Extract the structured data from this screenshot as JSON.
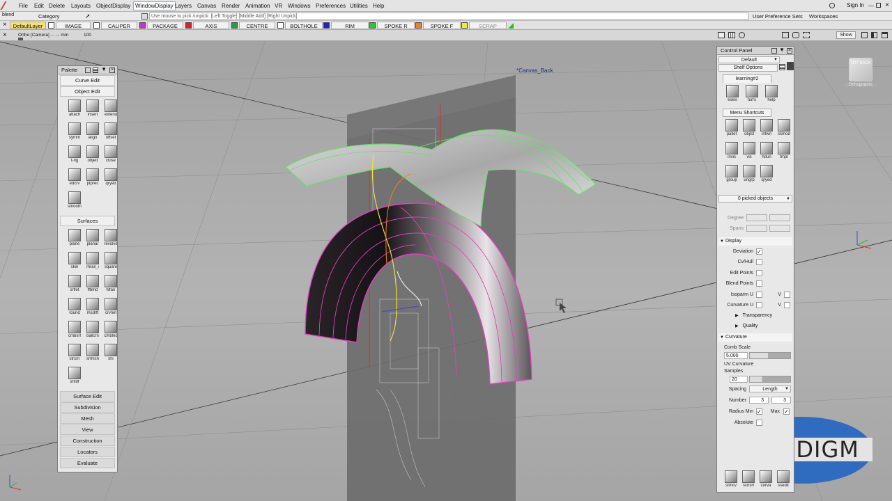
{
  "app": {
    "context_label": "blend",
    "sign_in": "Sign In"
  },
  "menubar": {
    "items": [
      "File",
      "Edit",
      "Delete",
      "Layouts",
      "ObjectDisplay",
      "WindowDisplay",
      "Layers",
      "Canvas",
      "Render",
      "Animation",
      "VR",
      "Windows",
      "Preferences",
      "Utilities",
      "Help"
    ],
    "active_item": "WindowDisplay"
  },
  "toolbar2": {
    "category_label": "Category",
    "hint": "Use mouse to pick /unpick: [Left Toggle] [Middle Add] [Right Unpick]",
    "user_pref_sets": "User Preference Sets",
    "workspaces": "Workspaces"
  },
  "layers": [
    {
      "label": "DefaultLayer",
      "color": "#f6e07a"
    },
    {
      "label": "IMAGE",
      "color": "#ffffff"
    },
    {
      "label": "CALIPER",
      "color": "#d22fd2"
    },
    {
      "label": "PACKAGE",
      "color": "#e02020"
    },
    {
      "label": "AXIS",
      "color": "#22a040"
    },
    {
      "label": "CENTRE",
      "color": "#ffffff"
    },
    {
      "label": "BOLTHOLE",
      "color": "#2020d0"
    },
    {
      "label": "RIM",
      "color": "#20d020"
    },
    {
      "label": "SPOKE R",
      "color": "#f08020"
    },
    {
      "label": "SPOKE F",
      "color": "#f0f020"
    },
    {
      "label": "SCRAP",
      "color": "#20c020"
    }
  ],
  "viewport": {
    "camera_label": "Ortho [Camera] ←→ mm",
    "zoom_value": "100",
    "canvas_label": "*Canvas_Back",
    "show_button": "Show",
    "viewcube_top": "TOP",
    "viewcube_side": "BACK",
    "viewcube_caption": "Orthographic"
  },
  "palette": {
    "title": "Palette",
    "sections_top": [
      "Curve Edit",
      "Object Edit"
    ],
    "object_edit_tools": [
      "attach",
      "insert",
      "extend",
      "symm",
      "align",
      "offset",
      "t-rlg",
      "objed",
      "close",
      "edcrv",
      "ptprec",
      "qryed",
      "smooth"
    ],
    "surfaces_label": "Surfaces",
    "surface_tools": [
      "plane",
      "planar",
      "revolve",
      "skin",
      "mrail_i",
      "square",
      "srflet",
      "ffblnd",
      "filfan",
      "round",
      "msdrft",
      "crvnet",
      "cmbsrf",
      "ballcrn",
      "cmblnd",
      "strcrn",
      "srfmsh",
      "sfs",
      "srfoff"
    ],
    "sections_bottom": [
      "Surface Edit",
      "Subdivision",
      "Mesh",
      "View",
      "Construction",
      "Locators",
      "Evaluate"
    ]
  },
  "control_panel": {
    "title": "Control Panel",
    "preset": "Default",
    "shelf_options": "Shelf Options",
    "shelf_tab": "learning#2",
    "shelf_tools": [
      "eskls",
      "turrs",
      "help"
    ],
    "menu_shortcuts_label": "Menu Shortcuts",
    "shortcut_tools": [
      "pallet",
      "objlst",
      "infwn",
      "ckmod",
      "invis",
      "vis",
      "hdun",
      "tmpl",
      "group",
      "ungrp",
      "qryed"
    ],
    "picked": "0 picked objects",
    "degree_label": "Degree",
    "spans_label": "Spans",
    "display_label": "Display",
    "display_items": [
      {
        "label": "Deviation",
        "checked": true
      },
      {
        "label": "Cv/Hull",
        "checked": false
      },
      {
        "label": "Edit Points",
        "checked": false
      },
      {
        "label": "Blend Points",
        "checked": false
      }
    ],
    "isoparm_u": "Isoparm U",
    "curvature_u": "Curvature U",
    "v_label": "V",
    "transparency": "Transparency",
    "quality": "Quality",
    "curvature_label": "Curvature",
    "comb_scale_label": "Comb Scale",
    "comb_scale_value": "5.000",
    "uv_curvature_label": "UV Curvature",
    "samples_label": "Samples",
    "samples_value": "20",
    "spacing_label": "Spacing",
    "spacing_value": "Length",
    "number_label": "Number",
    "number_u": "3",
    "number_v": "3",
    "radius_min_label": "Radius Min",
    "max_label": "Max",
    "absolute_label": "Absolute",
    "bottom_tools": [
      "sfmcv",
      "scnsrf",
      "curva",
      "ssedit"
    ]
  },
  "watermark": {
    "text": "GEODIGM",
    "color": "#2f6cc0"
  },
  "colors": {
    "rim_green": "#66e066",
    "spoke_magenta": "#e040c0",
    "axis_red": "#e03020"
  }
}
